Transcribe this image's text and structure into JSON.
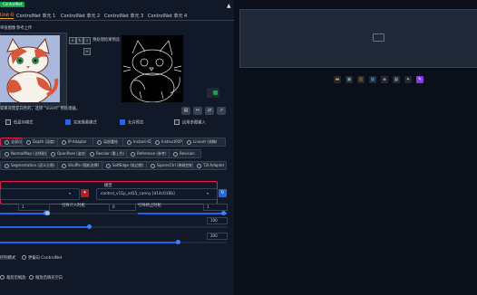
{
  "header": {
    "badge": "ControlNet",
    "collapse_icon": "triangle-up"
  },
  "tabs": [
    "Unit 0",
    "ControlNet 单元 1",
    "ControlNet 单元 2",
    "ControlNet 单元 3",
    "ControlNet 单元 4"
  ],
  "image_section": {
    "label_single": "单张图像",
    "label_batch": "批量处理",
    "label_upload": "参考上传",
    "preview_label": "预处理结果预览"
  },
  "tiny_buttons": [
    "×",
    "↻"
  ],
  "hint": "如果背景是白色的，选择 \"invert\" 预处理器。",
  "toolbar": [
    "▤",
    "↔",
    "⇄",
    "↗"
  ],
  "checkboxes": [
    {
      "label": "低显存模式",
      "checked": false
    },
    {
      "label": "完美像素模式",
      "checked": true
    },
    {
      "label": "允许预览",
      "checked": true
    },
    {
      "label": "启用多图输入",
      "checked": false
    }
  ],
  "control_types": [
    [
      "全部/边缘检测",
      "Depth (深度)",
      "IP-Adapter",
      "局部重绘",
      "Instant-ID",
      "InstructP2P",
      "Lineart (线稿)"
    ],
    [
      "NormalMap (法线贴图)",
      "OpenPose (姿态)",
      "Recolor (重上色)",
      "Reference (参考)",
      "Revision"
    ],
    [
      "Segmentation (语义分割)",
      "Shuffle (随机洗牌)",
      "SoftEdge (软边缘)",
      "SparseCtrl (稀疏控制)",
      "T2I-Adapter"
    ]
  ],
  "model_label": "模型",
  "model_value": "control_v11p_sd15_canny [d14c016b]",
  "sliders": [
    {
      "label": "控制权重",
      "value": "1"
    },
    {
      "label": "引导介入时机",
      "value": "0"
    },
    {
      "label": "引导终止时机",
      "value": "1"
    }
  ],
  "extra_values": [
    "100",
    "200"
  ],
  "control_mode": {
    "label": "控制模式",
    "option2": "更偏向 ControlNet"
  },
  "resize_mode": {
    "option1": "裁剪后缩放",
    "option2": "缩放后填充空白"
  },
  "colors": {
    "accent": "#2563eb",
    "highlight": "#e11d48",
    "badge": "#16a34a"
  }
}
